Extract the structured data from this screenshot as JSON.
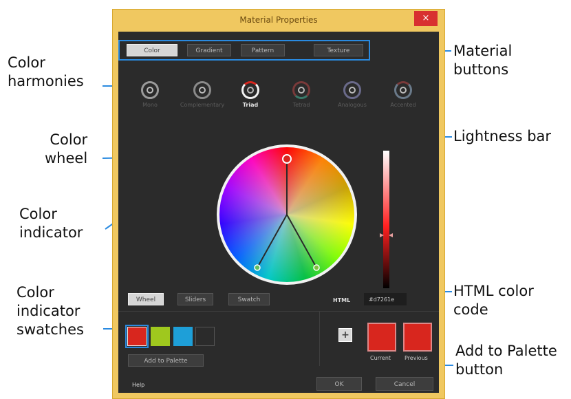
{
  "window": {
    "title": "Material Properties",
    "close_glyph": "×"
  },
  "material_tabs": [
    {
      "label": "Color",
      "active": true
    },
    {
      "label": "Gradient",
      "active": false
    },
    {
      "label": "Pattern",
      "active": false
    },
    {
      "label": "Texture",
      "active": false
    }
  ],
  "harmonies": [
    {
      "label": "Mono",
      "selected": false
    },
    {
      "label": "Complementary",
      "selected": false
    },
    {
      "label": "Triad",
      "selected": true
    },
    {
      "label": "Tetrad",
      "selected": false
    },
    {
      "label": "Analogous",
      "selected": false
    },
    {
      "label": "Accented",
      "selected": false
    }
  ],
  "view_tabs": [
    {
      "label": "Wheel",
      "active": true
    },
    {
      "label": "Sliders",
      "active": false
    },
    {
      "label": "Swatch",
      "active": false
    }
  ],
  "html_code": {
    "label": "HTML",
    "value": "#d7261e"
  },
  "indicator_swatches": [
    {
      "color": "#d8261e",
      "selected": true
    },
    {
      "color": "#9fc81e",
      "selected": false
    },
    {
      "color": "#1e9fd8",
      "selected": false
    },
    {
      "color": "#2b2b2b",
      "selected": false
    }
  ],
  "buttons": {
    "add_to_palette": "Add to Palette",
    "plus_glyph": "+",
    "help": "Help",
    "ok": "OK",
    "cancel": "Cancel"
  },
  "preview": {
    "current_label": "Current",
    "previous_label": "Previous",
    "current_color": "#d8261e",
    "previous_color": "#d8261e"
  },
  "callouts": {
    "color_harmonies": "Color\nharmonies",
    "color_wheel": "Color\nwheel",
    "color_indicator": "Color\nindicator",
    "color_indicator_swatches": "Color\nindicator\nswatches",
    "material_buttons": "Material\nbuttons",
    "lightness_bar": "Lightness bar",
    "html_color_code": "HTML color\ncode",
    "add_to_palette_button": "Add to Palette\nbutton"
  },
  "colors": {
    "accent": "#2a8ae0",
    "dialog_frame": "#f0c860",
    "dialog_body": "#2b2b2b"
  }
}
